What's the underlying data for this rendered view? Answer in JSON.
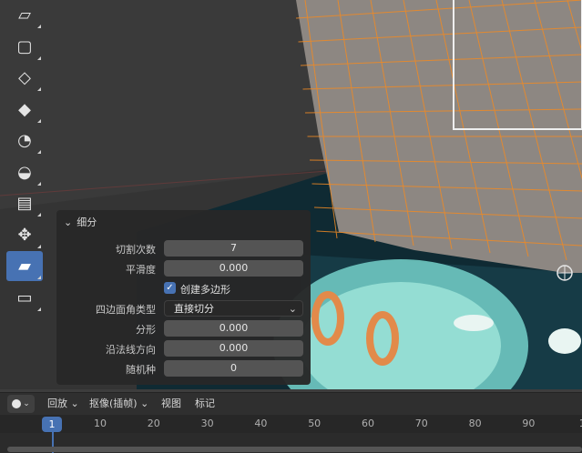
{
  "toolbar": {
    "tools": [
      {
        "name": "extrude-region-icon"
      },
      {
        "name": "inset-faces-icon"
      },
      {
        "name": "bevel-icon"
      },
      {
        "name": "loop-cut-icon"
      },
      {
        "name": "knife-icon"
      },
      {
        "name": "poly-build-icon"
      },
      {
        "name": "spin-icon"
      },
      {
        "name": "smooth-icon"
      },
      {
        "name": "edge-slide-icon"
      },
      {
        "name": "shrink-fatten-icon"
      }
    ],
    "active_index": 8
  },
  "panel": {
    "title": "细分",
    "rows": {
      "cuts": {
        "label": "切割次数",
        "value": "7"
      },
      "smoothness": {
        "label": "平滑度",
        "value": "0.000"
      },
      "create_ngons": {
        "label": "创建多边形",
        "checked": true
      },
      "quad_corner": {
        "label": "四边面角类型",
        "value": "直接切分"
      },
      "fractal": {
        "label": "分形",
        "value": "0.000"
      },
      "along_normal": {
        "label": "沿法线方向",
        "value": "0.000"
      },
      "seed": {
        "label": "随机种",
        "value": "0"
      }
    }
  },
  "timeline": {
    "menus": {
      "playback": "回放",
      "keying": "抠像(插帧)",
      "view": "视图",
      "marker": "标记"
    },
    "current_frame": "1",
    "ruler_numbers": [
      "10",
      "20",
      "30",
      "40",
      "50",
      "60",
      "70",
      "80",
      "90",
      "1"
    ]
  },
  "colors": {
    "accent": "#4772b3",
    "mesh_edge": "#f08a24",
    "mesh_face": "#8d8782"
  }
}
